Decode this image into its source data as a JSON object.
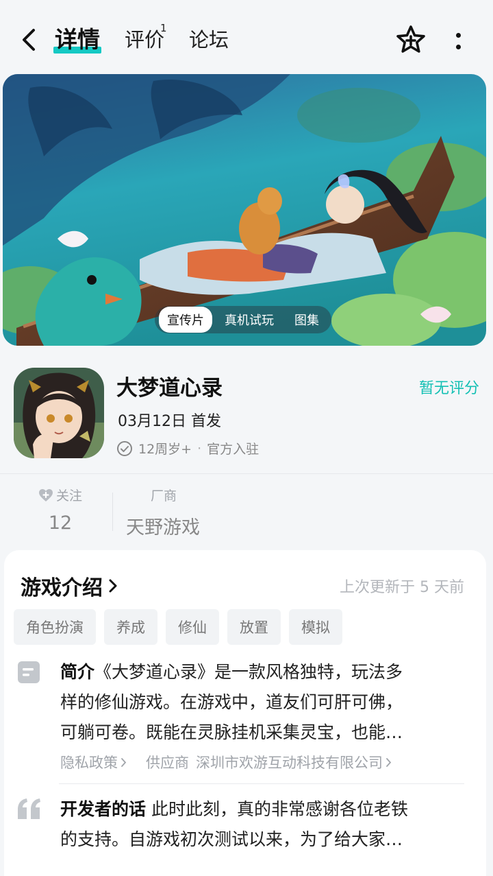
{
  "header": {
    "tabs": [
      {
        "label": "详情",
        "active": true
      },
      {
        "label": "评价",
        "badge": "1"
      },
      {
        "label": "论坛"
      }
    ]
  },
  "banner": {
    "media_tabs": [
      "宣传片",
      "真机试玩",
      "图集"
    ],
    "active_media_tab": "宣传片"
  },
  "game": {
    "title": "大梦道心录",
    "release": "03月12日 首发",
    "age": "12周岁+",
    "badge": "官方入驻",
    "rating": "暂无评分"
  },
  "stats": {
    "follow_label": "关注",
    "follow_value": "12",
    "developer_label": "厂商",
    "developer_value": "天野游戏"
  },
  "intro": {
    "title": "游戏介绍",
    "updated": "上次更新于 5 天前",
    "tags": [
      "角色扮演",
      "养成",
      "修仙",
      "放置",
      "模拟"
    ],
    "desc_label": "简介",
    "desc_line1": "《大梦道心录》是一款风格独特，玩法多",
    "desc_line2": "样的修仙游戏。在游戏中，道友们可肝可佛，",
    "desc_line3": "可躺可卷。既能在灵脉挂机采集灵宝，也能…",
    "privacy_label": "隐私政策",
    "supplier_label": "供应商",
    "supplier_value": "深圳市欢游互动科技有限公司",
    "dev_words_label": "开发者的话",
    "dev_line1": "此时此刻，真的非常感谢各位老铁",
    "dev_line2": "的支持。自游戏初次测试以来，为了给大家…"
  },
  "colors": {
    "accent": "#14c9c4",
    "rating": "#14c0b4"
  }
}
